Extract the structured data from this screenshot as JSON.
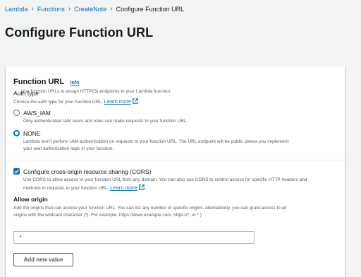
{
  "breadcrumb": {
    "items": [
      "Lambda",
      "Functions",
      "CreateNote"
    ],
    "current": "Configure Function URL"
  },
  "page": {
    "title": "Configure Function URL"
  },
  "panel": {
    "title": "Function URL",
    "info": "Info",
    "description": "Use function URLs to assign HTTP(S) endpoints to your Lambda function."
  },
  "auth": {
    "label": "Auth type",
    "description": "Choose the auth type for your function URL.",
    "learn_more": "Learn more",
    "options": [
      {
        "label": "AWS_IAM",
        "description": "Only authenticated IAM users and roles can make requests to your function URL.",
        "selected": false
      },
      {
        "label": "NONE",
        "description_1": "Lambda won't perform IAM authentication on requests to your function URL. The URL endpoint will be public unless you implement",
        "description_2": "your own authorization logic in your function.",
        "selected": true
      }
    ]
  },
  "cors": {
    "checked": true,
    "label": "Configure cross-origin resource sharing (CORS)",
    "description_1": "Use CORS to allow access to your function URL from any domain. You can also use CORS to control access for specific HTTP headers and",
    "description_2": "methods in requests to your function URL.",
    "learn_more": "Learn more"
  },
  "allow_origin": {
    "label": "Allow origin",
    "description_1": "Add the origins that can access your function URL. You can list any number of specific origins. Alternatively, you can grant access to all",
    "description_2": "origins with the wildcard character (*). For example: https://www.example.com, https://*, or *.)",
    "value": "*",
    "add_button": "Add new value"
  },
  "colors": {
    "link": "#0073bb",
    "background": "#f2f3f3",
    "text": "#16191f",
    "muted": "#545b64"
  },
  "icons": {
    "separator": "chevron-right-icon",
    "external": "external-link-icon"
  }
}
